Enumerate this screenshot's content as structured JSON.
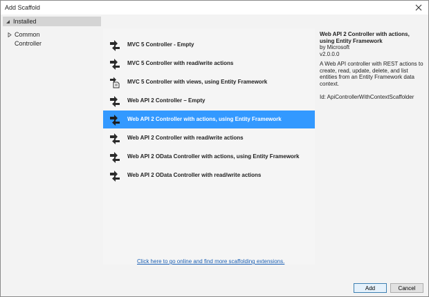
{
  "window": {
    "title": "Add Scaffold"
  },
  "tree": {
    "header": "Installed",
    "items": [
      {
        "label": "Common"
      },
      {
        "label": "Controller"
      }
    ]
  },
  "templates": [
    {
      "label": "MVC 5 Controller - Empty",
      "icon": "controller-icon"
    },
    {
      "label": "MVC 5 Controller with read/write actions",
      "icon": "controller-icon"
    },
    {
      "label": "MVC 5 Controller with views, using Entity Framework",
      "icon": "controller-views-icon"
    },
    {
      "label": "Web API 2 Controller – Empty",
      "icon": "controller-icon"
    },
    {
      "label": "Web API 2 Controller with actions, using Entity Framework",
      "icon": "controller-icon",
      "selected": true
    },
    {
      "label": "Web API 2 Controller with read/write actions",
      "icon": "controller-icon"
    },
    {
      "label": "Web API 2 OData Controller with actions, using Entity Framework",
      "icon": "controller-icon"
    },
    {
      "label": "Web API 2 OData Controller with read/write actions",
      "icon": "controller-icon"
    }
  ],
  "details": {
    "title": "Web API 2 Controller with actions, using Entity Framework",
    "by": "by Microsoft",
    "version": "v2.0.0.0",
    "description": "A Web API controller with REST actions to create, read, update, delete, and list entities from an Entity Framework data context.",
    "id": "Id: ApiControllerWithContextScaffolder"
  },
  "link": "Click here to go online and find more scaffolding extensions.",
  "buttons": {
    "add": "Add",
    "cancel": "Cancel"
  },
  "colors": {
    "selection": "#3399ff",
    "link": "#1a5fb4"
  }
}
